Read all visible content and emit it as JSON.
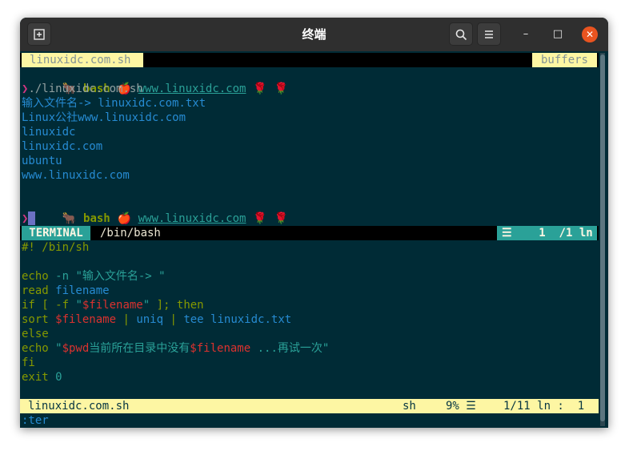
{
  "window": {
    "title": "终端",
    "new_tab_icon": "new-tab-icon",
    "search_icon": "search-icon",
    "menu_icon": "hamburger-menu-icon",
    "minimize": "–",
    "maximize": "□",
    "close": "✕"
  },
  "tabline": {
    "active_tab": "linuxidc.com.sh",
    "right_label": "buffers"
  },
  "terminal": {
    "prompt_name": "bash",
    "prompt_link": "www.linuxidc.com",
    "command": "./linuxidc.com.sh",
    "output": [
      "输入文件名-> linuxidc.com.txt",
      "Linux公社www.linuxidc.com",
      "linuxidc",
      "linuxidc.com",
      "ubuntu",
      "www.linuxidc.com"
    ],
    "prompt_char": "❯"
  },
  "terminal_status": {
    "mode": "TERMINAL",
    "name": "/bin/bash",
    "right": "☰    1  /1 ln"
  },
  "script": {
    "shebang": "#! /bin/sh",
    "l3_cmd": "echo",
    "l3_flag": " -n ",
    "l3_str": "\"输入文件名-> \"",
    "l4_cmd": "read",
    "l4_arg": " filename",
    "l5_if": "if [ -f ",
    "l5_q1": "\"",
    "l5_var": "$filename",
    "l5_q2": "\"",
    "l5_rest": " ]; then",
    "l6_cmd": "sort",
    "l6_var": " $filename",
    "l6_pipe1": " | ",
    "l6_uniq": "uniq",
    "l6_pipe2": " | ",
    "l6_tee": "tee linuxidc.txt",
    "l7": "else",
    "l8_cmd": "echo",
    "l8_q1": " \"",
    "l8_var1": "$pwd",
    "l8_text": "当前所在目录中没有",
    "l8_var2": "$filename",
    "l8_text2": " ...再试一次",
    "l8_q2": "\"",
    "l9": "fi",
    "l10_cmd": "exit",
    "l10_num": " 0"
  },
  "editor_status": {
    "filename": "linuxidc.com.sh",
    "filetype": "sh",
    "percent": "9% ☰",
    "position": "1/11 ln :  1"
  },
  "command_line": ":ter"
}
